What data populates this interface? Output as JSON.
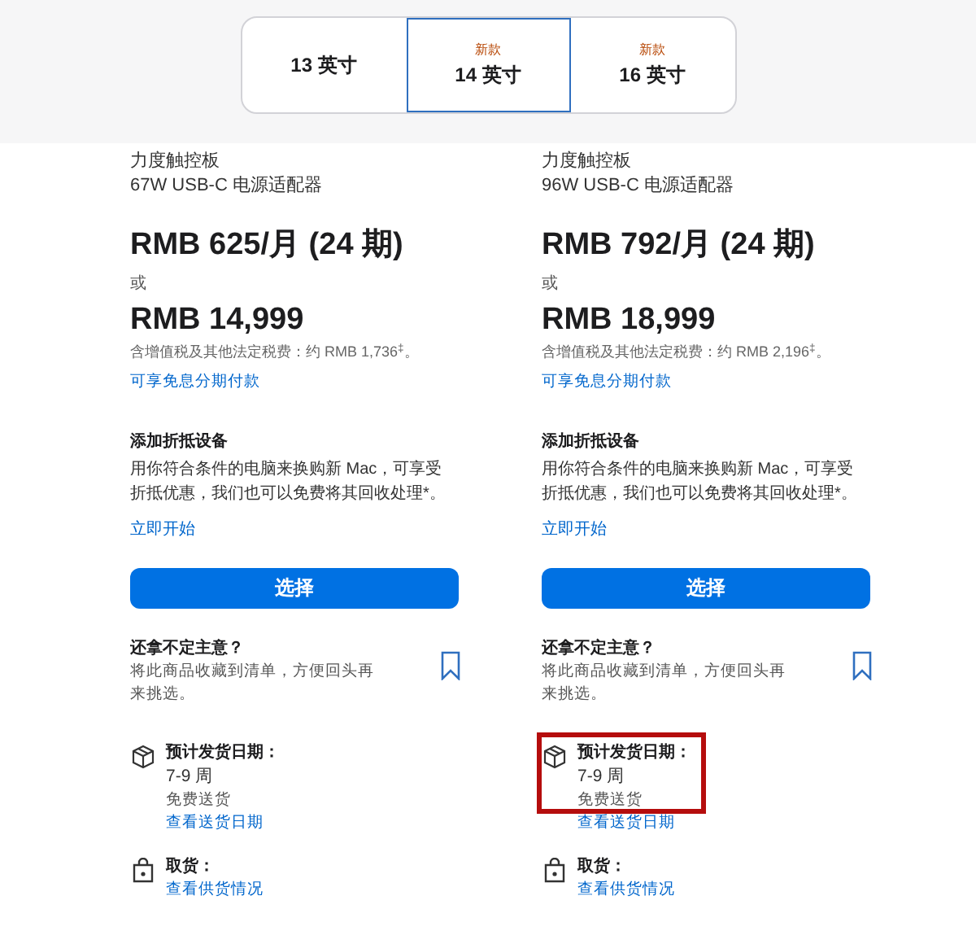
{
  "size_tabs": [
    {
      "label": "13 英寸",
      "selected": false
    },
    {
      "label": "14 英寸",
      "badge": "新款",
      "selected": true
    },
    {
      "label": "16 英寸",
      "badge": "新款",
      "selected": false
    }
  ],
  "products": [
    {
      "features": [
        "力度触控板",
        "67W USB-C 电源适配器"
      ],
      "monthly_price": "RMB 625/月 (24 期)",
      "or": "或",
      "price": "RMB 14,999",
      "tax_note": "含增值税及其他法定税费：约 RMB 1,736$^{‡}$。",
      "installment_link": "可享免息分期付款",
      "trade_in_title": "添加折抵设备",
      "trade_in_text": "用你符合条件的电脑来换购新 Mac，可享受折抵优惠，我们也可以免费将其回收处理*。",
      "trade_in_link": "立即开始",
      "select_button": "选择",
      "save_title": "还拿不定主意？",
      "save_text": "将此商品收藏到清单，方便回头再来挑选。",
      "delivery": {
        "title": "预计发货日期：",
        "time": "7-9 周",
        "shipping": "免费送货",
        "link": "查看送货日期",
        "highlighted": false
      },
      "pickup": {
        "title": "取货：",
        "link": "查看供货情况"
      }
    },
    {
      "features": [
        "力度触控板",
        "96W USB-C 电源适配器"
      ],
      "monthly_price": "RMB 792/月 (24 期)",
      "or": "或",
      "price": "RMB 18,999",
      "tax_note": "含增值税及其他法定税费：约 RMB 2,196$^{‡}$。",
      "installment_link": "可享免息分期付款",
      "trade_in_title": "添加折抵设备",
      "trade_in_text": "用你符合条件的电脑来换购新 Mac，可享受折抵优惠，我们也可以免费将其回收处理*。",
      "trade_in_link": "立即开始",
      "select_button": "选择",
      "save_title": "还拿不定主意？",
      "save_text": "将此商品收藏到清单，方便回头再来挑选。",
      "delivery": {
        "title": "预计发货日期：",
        "time": "7-9 周",
        "shipping": "免费送货",
        "link": "查看送货日期",
        "highlighted": true
      },
      "pickup": {
        "title": "取货：",
        "link": "查看供货情况"
      }
    }
  ]
}
